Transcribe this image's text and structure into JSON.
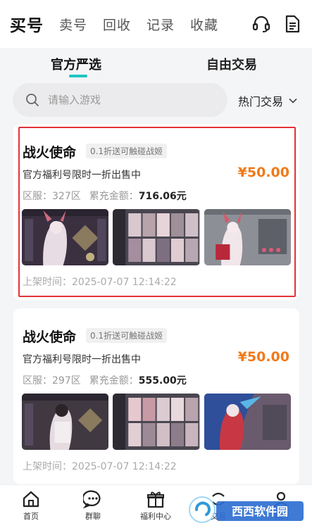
{
  "topbar": {
    "tabs": [
      {
        "label": "买号",
        "active": true
      },
      {
        "label": "卖号",
        "active": false
      },
      {
        "label": "回收",
        "active": false
      },
      {
        "label": "记录",
        "active": false
      },
      {
        "label": "收藏",
        "active": false
      }
    ],
    "icons": [
      "headset-icon",
      "document-icon"
    ]
  },
  "subtabs": {
    "official": "官方严选",
    "free": "自由交易"
  },
  "search": {
    "placeholder": "请输入游戏",
    "sort_label": "热门交易"
  },
  "listings": [
    {
      "title": "战火使命",
      "tag": "0.1折送可触碰战姬",
      "desc": "官方福利号限时一折出售中",
      "price": "¥50.00",
      "server_label": "区服：",
      "server": "327区",
      "recharge_label": "累充金额：",
      "recharge": "716.06元",
      "time_label": "上架时间：",
      "time": "2025-07-07 12:14:22",
      "highlighted": true
    },
    {
      "title": "战火使命",
      "tag": "0.1折送可触碰战姬",
      "desc": "官方福利号限时一折出售中",
      "price": "¥50.00",
      "server_label": "区服：",
      "server": "297区",
      "recharge_label": "累充金额：",
      "recharge": "555.00元",
      "time_label": "上架时间：",
      "time": "2025-07-07 12:14:22",
      "highlighted": false
    }
  ],
  "bottomnav": {
    "items": [
      {
        "label": "首页",
        "icon": "home-icon"
      },
      {
        "label": "群聊",
        "icon": "chat-icon"
      },
      {
        "label": "福利中心",
        "icon": "gift-icon"
      },
      {
        "label": "交易",
        "icon": "trade-icon"
      },
      {
        "label": "我的",
        "icon": "user-icon"
      }
    ]
  },
  "watermark": {
    "text": "西西软件园"
  },
  "colors": {
    "accent": "#1fc6c4",
    "price": "#f07a1a",
    "highlight": "#e2333a"
  }
}
